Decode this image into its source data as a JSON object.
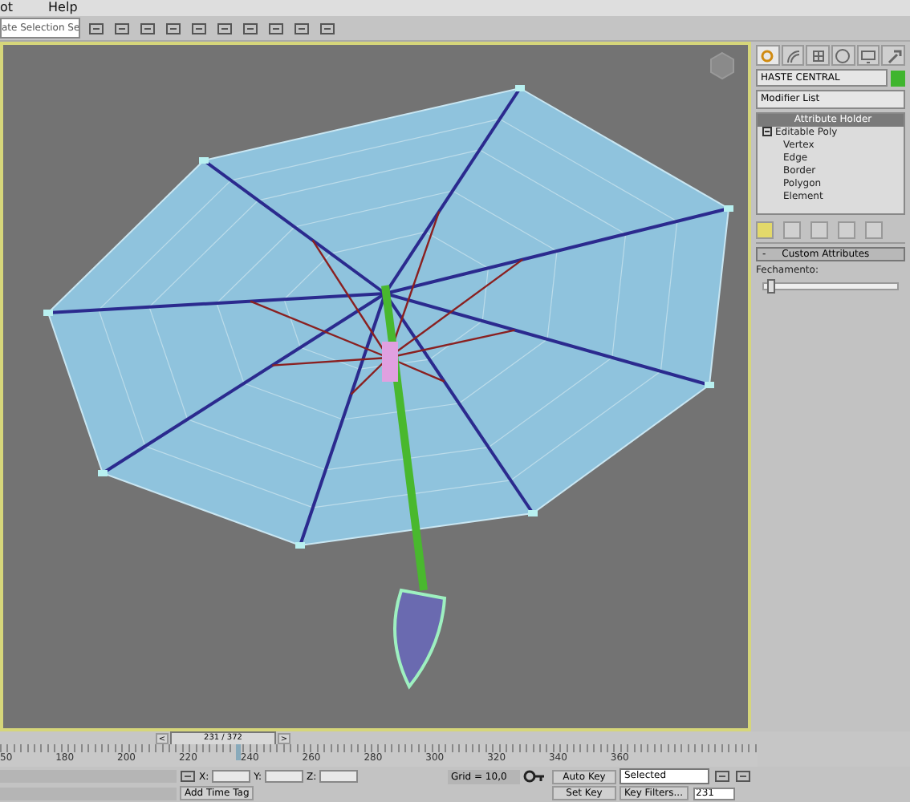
{
  "menu": [
    {
      "label": "ot"
    },
    {
      "label": "Help"
    }
  ],
  "toolbar": {
    "selection_set": "ate Selection Se"
  },
  "command_panel": {
    "tabs": [
      {
        "kind": "create",
        "selected": true
      },
      {
        "kind": "modify",
        "selected": false
      },
      {
        "kind": "hierarchy",
        "selected": false
      },
      {
        "kind": "motion",
        "selected": false
      },
      {
        "kind": "display",
        "selected": false
      },
      {
        "kind": "utilities",
        "selected": false
      }
    ],
    "object_name": "HASTE CENTRAL",
    "modifier_list": "Modifier List",
    "stack": [
      {
        "label": "Attribute Holder",
        "selected": true
      },
      {
        "label": "Editable Poly",
        "selected": false,
        "expanded": true,
        "children": [
          {
            "label": "Vertex",
            "selected": false
          },
          {
            "label": "Edge",
            "selected": false
          },
          {
            "label": "Border",
            "selected": false
          },
          {
            "label": "Polygon",
            "selected": false
          },
          {
            "label": "Element",
            "selected": false
          }
        ]
      }
    ],
    "rollout": {
      "title": "Custom Attributes",
      "toggle": "-",
      "params": [
        {
          "label": "Fechamento:",
          "level": 0.03
        }
      ]
    }
  },
  "timeline": {
    "level": 0.25,
    "prev": "<",
    "frame_label": "231 / 372",
    "next": ">",
    "ticks": [
      "50",
      "180",
      "200",
      "220",
      "240",
      "260",
      "280",
      "300",
      "320",
      "340",
      "360"
    ]
  },
  "status": {
    "x_label": "X:",
    "y_label": "Y:",
    "z_label": "Z:",
    "grid": "Grid = 10,0",
    "auto_key": "Auto Key",
    "key_mode": "Selected",
    "set_key": "Set Key",
    "key_filters": "Key Filters...",
    "add_time_tag": "Add Time Tag",
    "frame": "231"
  }
}
